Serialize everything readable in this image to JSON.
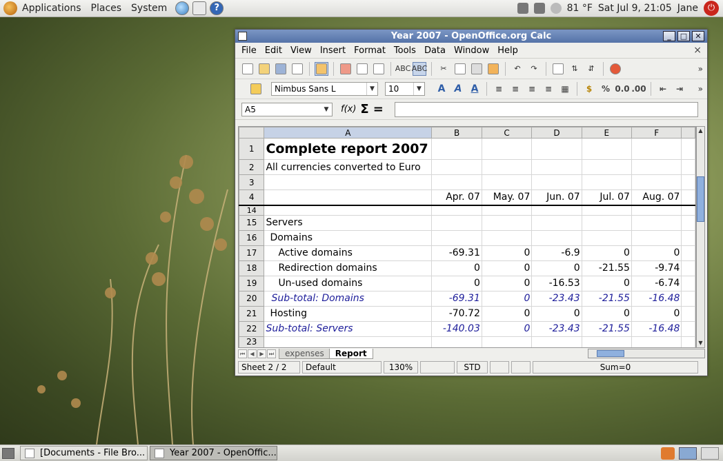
{
  "top_panel": {
    "menus": [
      "Applications",
      "Places",
      "System"
    ],
    "weather": "81 °F",
    "clock": "Sat Jul  9, 21:05",
    "user": "Jane"
  },
  "window": {
    "title": "Year 2007 - OpenOffice.org Calc",
    "menu": [
      "File",
      "Edit",
      "View",
      "Insert",
      "Format",
      "Tools",
      "Data",
      "Window",
      "Help"
    ],
    "close_doc": "×"
  },
  "format_toolbar": {
    "font_name": "Nimbus Sans L",
    "font_size": "10"
  },
  "formula_bar": {
    "name_box": "A5",
    "fx": "f(x)",
    "sigma": "Σ",
    "equals": "="
  },
  "sheet": {
    "columns": [
      "A",
      "B",
      "C",
      "D",
      "E",
      "F"
    ],
    "rows": [
      {
        "n": "1",
        "cells": [
          "Complete report 2007",
          "",
          "",
          "",
          "",
          ""
        ]
      },
      {
        "n": "2",
        "cells": [
          "All currencies converted to Euro",
          "",
          "",
          "",
          "",
          ""
        ]
      },
      {
        "n": "3",
        "cells": [
          "",
          "",
          "",
          "",
          "",
          ""
        ]
      },
      {
        "n": "4",
        "cells": [
          "",
          "Apr. 07",
          "May. 07",
          "Jun. 07",
          "Jul. 07",
          "Aug. 07"
        ]
      },
      {
        "n": "14",
        "cells": [
          "",
          "",
          "",
          "",
          "",
          ""
        ]
      },
      {
        "n": "15",
        "cells": [
          "Servers",
          "",
          "",
          "",
          "",
          ""
        ]
      },
      {
        "n": "16",
        "cells": [
          "Domains",
          "",
          "",
          "",
          "",
          ""
        ]
      },
      {
        "n": "17",
        "cells": [
          "Active domains",
          "-69.31",
          "0",
          "-6.9",
          "0",
          "0"
        ]
      },
      {
        "n": "18",
        "cells": [
          "Redirection domains",
          "0",
          "0",
          "0",
          "-21.55",
          "-9.74"
        ]
      },
      {
        "n": "19",
        "cells": [
          "Un-used domains",
          "0",
          "0",
          "-16.53",
          "0",
          "-6.74"
        ]
      },
      {
        "n": "20",
        "cells": [
          "Sub-total: Domains",
          "-69.31",
          "0",
          "-23.43",
          "-21.55",
          "-16.48"
        ]
      },
      {
        "n": "21",
        "cells": [
          "Hosting",
          "-70.72",
          "0",
          "0",
          "0",
          "0"
        ]
      },
      {
        "n": "22",
        "cells": [
          "Sub-total: Servers",
          "-140.03",
          "0",
          "-23.43",
          "-21.55",
          "-16.48"
        ]
      },
      {
        "n": "23",
        "cells": [
          "",
          "",
          "",
          "",
          "",
          ""
        ]
      }
    ],
    "tabs": [
      "expenses",
      "Report"
    ],
    "active_tab": "Report"
  },
  "status_bar": {
    "sheet": "Sheet 2 / 2",
    "style": "Default",
    "zoom": "130%",
    "mode": "STD",
    "sum": "Sum=0"
  },
  "taskbar": {
    "tasks": [
      "[Documents - File Bro...",
      "Year 2007 - OpenOffic..."
    ]
  }
}
